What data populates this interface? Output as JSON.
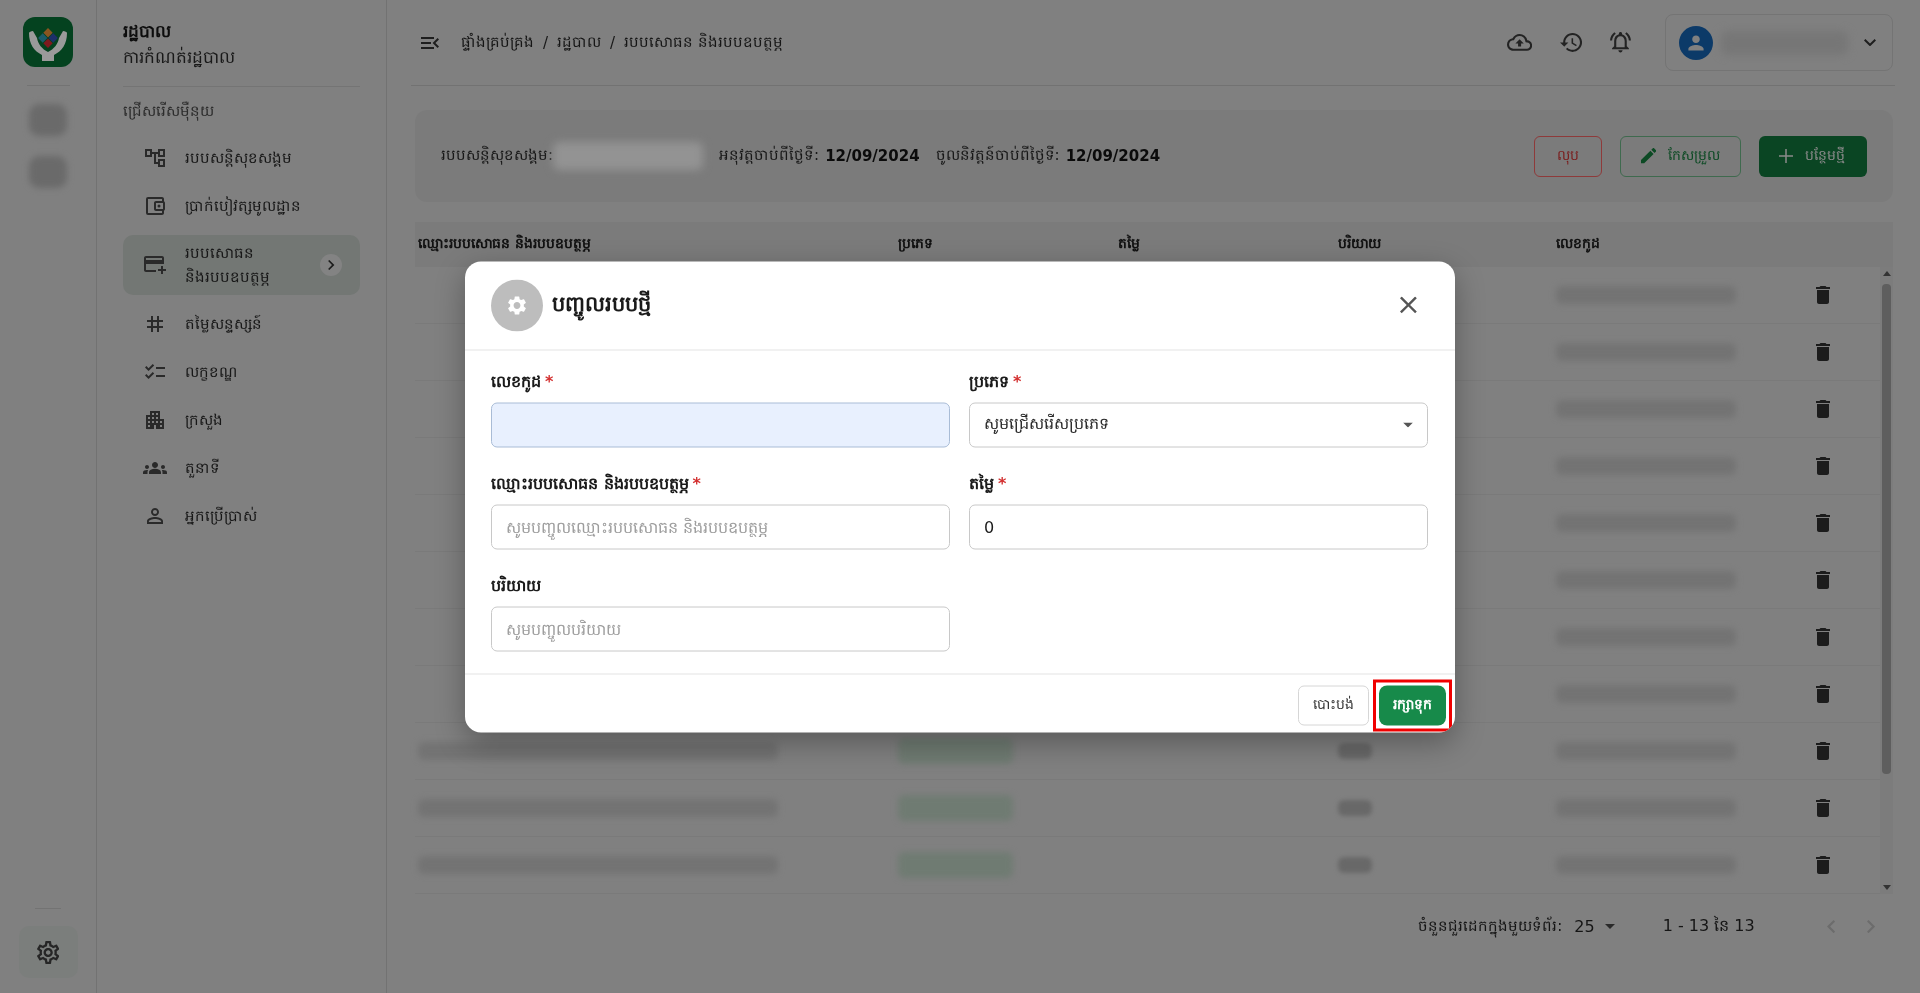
{
  "app_rail": {
    "items": [
      {
        "kind": "redacted"
      },
      {
        "kind": "redacted"
      }
    ]
  },
  "sidebar": {
    "title": "រដ្ឋបាល",
    "subtitle": "ការកំណត់រដ្ឋបាល",
    "section_label": "ជ្រើសរើសម៉ឺនុយ",
    "items": [
      {
        "label": "របបសន្តិសុខសង្គម",
        "selected": false
      },
      {
        "label": "ប្រាក់បៀវត្សមូលដ្ឋាន",
        "selected": false
      },
      {
        "label": "របបសោធន និងរបបឧបត្ថម្ភ",
        "selected": true
      },
      {
        "label": "តម្លៃសន្ទស្សន៍",
        "selected": false
      },
      {
        "label": "លក្ខខណ្ឌ",
        "selected": false
      },
      {
        "label": "ក្រសួង",
        "selected": false
      },
      {
        "label": "តួនាទី",
        "selected": false
      },
      {
        "label": "អ្នកប្រើប្រាស់",
        "selected": false
      }
    ]
  },
  "header": {
    "breadcrumb": [
      "ផ្ទាំងគ្រប់គ្រង",
      "រដ្ឋបាល",
      "របបសោធន និងរបបឧបត្ថម្ភ"
    ],
    "separator": "/"
  },
  "info": {
    "items": [
      {
        "kind": "redacted",
        "label": "របបសន្តិសុខសង្គម:"
      },
      {
        "kind": "text",
        "label": "អនុវត្តចាប់ពីថ្ងៃទី:",
        "value": "12/09/2024"
      },
      {
        "kind": "text",
        "label": "ចូលនិវត្តន៍ចាប់ពីថ្ងៃទី:",
        "value": "12/09/2024"
      }
    ],
    "buttons": [
      {
        "kind": "danger",
        "label": "លុប"
      },
      {
        "kind": "edit",
        "label": "កែសម្រួល"
      },
      {
        "kind": "add",
        "label": "បន្ថែមថ្មី"
      }
    ]
  },
  "table": {
    "columns": [
      "ឈ្មោះរបបសោធន និងរបបឧបត្ថម្ភ",
      "ប្រភេទ",
      "តម្លៃ",
      "បរិយាយ",
      "លេខកូដ"
    ],
    "rows": [
      {
        "kind": "redacted"
      },
      {
        "kind": "redacted"
      },
      {
        "kind": "redacted"
      },
      {
        "kind": "redacted"
      },
      {
        "kind": "redacted"
      },
      {
        "kind": "redacted"
      },
      {
        "kind": "redacted"
      },
      {
        "kind": "redacted"
      },
      {
        "kind": "redacted"
      },
      {
        "kind": "redacted"
      },
      {
        "kind": "redacted"
      }
    ]
  },
  "pagination": {
    "rows_per_page_label": "ចំនួនជួរដេកក្នុងមួយទំព័រ:",
    "rows_per_page": "25",
    "range": "1 - 13 នៃ 13",
    "prev_disabled": true,
    "next_disabled": true
  },
  "modal": {
    "title": "បញ្ចូលរបបថ្មី",
    "fields": [
      {
        "kind": "text",
        "label": "លេខកូដ",
        "required_mark": "*",
        "autofilled": true
      },
      {
        "kind": "select",
        "label": "ប្រភេទ",
        "required_mark": "*",
        "value": "សូមជ្រើសរើសប្រភេទ"
      },
      {
        "kind": "text",
        "label": "ឈ្មោះរបបសោធន និងរបបឧបត្ថម្ភ",
        "required_mark": "*",
        "placeholder": "សូមបញ្ចូលឈ្មោះរបបសោធន និងរបបឧបត្ថម្ភ",
        "autofilled": false
      },
      {
        "kind": "text",
        "label": "តម្លៃ",
        "required_mark": "*",
        "value": "0",
        "autofilled": false
      },
      {
        "kind": "text",
        "label": "បរិយាយ",
        "placeholder": "សូមបញ្ចូលបរិយាយ",
        "autofilled": false
      }
    ],
    "buttons": [
      {
        "kind": "secondary",
        "label": "បោះបង់",
        "highlighted": false
      },
      {
        "kind": "primary",
        "label": "រក្សាទុក",
        "highlighted": true
      }
    ]
  }
}
